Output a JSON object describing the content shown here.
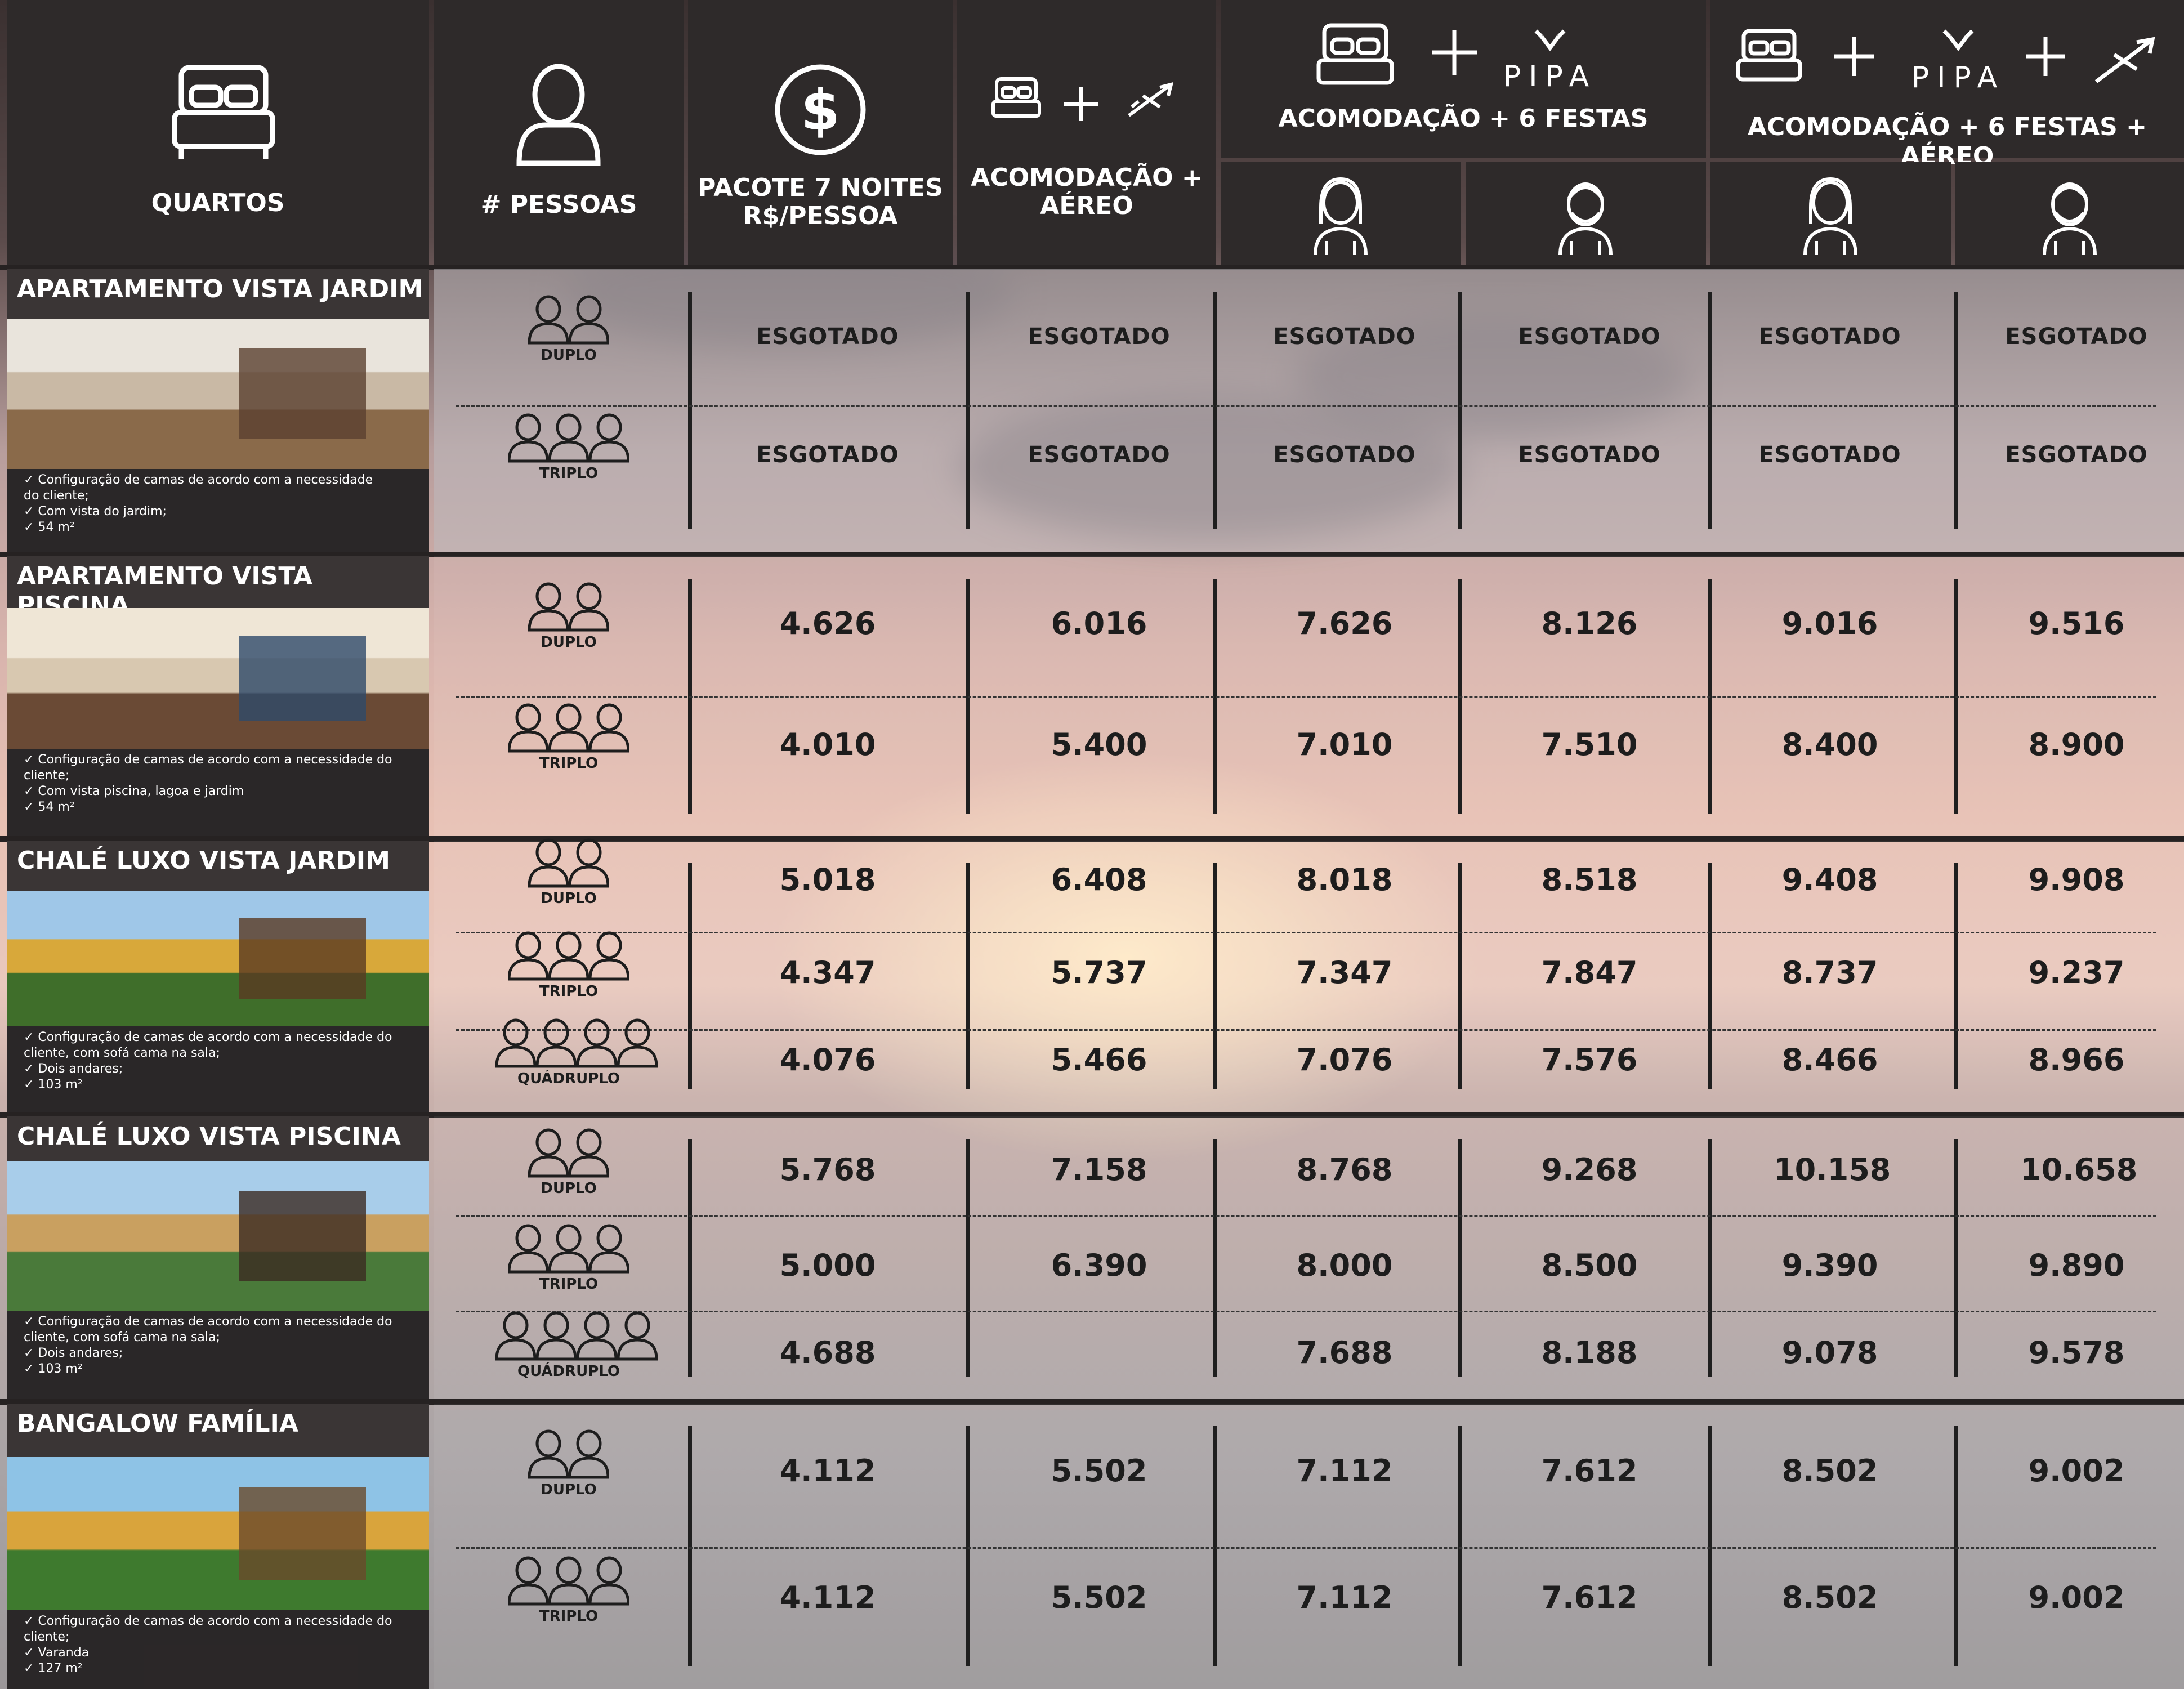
{
  "headers": {
    "quartos": "QUARTOS",
    "pessoas": "# PESSOAS",
    "pacote": [
      "PACOTE 7 NOITES",
      "R$/PESSOA"
    ],
    "acomodacao_aereo": [
      "ACOMODAÇÃO +",
      "AÉREO"
    ],
    "acomodacao_festas": "ACOMODAÇÃO + 6 FESTAS",
    "acomodacao_festas_aereo": "ACOMODAÇÃO + 6 FESTAS + AÉREO",
    "pipa_logo": "PIPA"
  },
  "icons": {
    "bed": "bed-icon",
    "person": "person-icon",
    "dollar": "dollar-icon",
    "plane": "plane-icon",
    "plus": "plus-icon",
    "woman": "woman-icon",
    "man": "man-icon",
    "people": "people-icon"
  },
  "colors": {
    "header_bg": "#2e2a2a",
    "panel_bg": "#3a3535",
    "text_dark": "#1d1d1d"
  },
  "rooms": [
    {
      "title": "APARTAMENTO VISTA JARDIM",
      "features": [
        "✓  Configuração de camas de acordo com a necessidade",
        "    do cliente;",
        "✓  Com vista do jardim;",
        "✓  54 m²"
      ],
      "rows": [
        {
          "occupancy": "DUPLO",
          "values": [
            "ESGOTADO",
            "ESGOTADO",
            "ESGOTADO",
            "ESGOTADO",
            "ESGOTADO",
            "ESGOTADO"
          ]
        },
        {
          "occupancy": "TRIPLO",
          "values": [
            "ESGOTADO",
            "ESGOTADO",
            "ESGOTADO",
            "ESGOTADO",
            "ESGOTADO",
            "ESGOTADO"
          ]
        }
      ]
    },
    {
      "title": "APARTAMENTO VISTA PISCINA",
      "features": [
        "✓  Configuração de camas de acordo com a necessidade do",
        "    cliente;",
        "✓  Com vista piscina, lagoa e jardim",
        "✓  54 m²"
      ],
      "rows": [
        {
          "occupancy": "DUPLO",
          "values": [
            "4.626",
            "6.016",
            "7.626",
            "8.126",
            "9.016",
            "9.516"
          ]
        },
        {
          "occupancy": "TRIPLO",
          "values": [
            "4.010",
            "5.400",
            "7.010",
            "7.510",
            "8.400",
            "8.900"
          ]
        }
      ]
    },
    {
      "title": "CHALÉ LUXO VISTA JARDIM",
      "features": [
        "✓  Configuração de camas de acordo com a necessidade do",
        "    cliente, com sofá cama na sala;",
        "✓  Dois andares;",
        "✓  103 m²"
      ],
      "rows": [
        {
          "occupancy": "DUPLO",
          "values": [
            "5.018",
            "6.408",
            "8.018",
            "8.518",
            "9.408",
            "9.908"
          ]
        },
        {
          "occupancy": "TRIPLO",
          "values": [
            "4.347",
            "5.737",
            "7.347",
            "7.847",
            "8.737",
            "9.237"
          ]
        },
        {
          "occupancy": "QUÁDRUPLO",
          "values": [
            "4.076",
            "5.466",
            "7.076",
            "7.576",
            "8.466",
            "8.966"
          ]
        }
      ]
    },
    {
      "title": "CHALÉ LUXO VISTA PISCINA",
      "features": [
        "✓  Configuração de camas de acordo com a necessidade do",
        "    cliente, com sofá cama na sala;",
        "✓  Dois andares;",
        "✓  103 m²"
      ],
      "rows": [
        {
          "occupancy": "DUPLO",
          "values": [
            "5.768",
            "7.158",
            "8.768",
            "9.268",
            "10.158",
            "10.658"
          ]
        },
        {
          "occupancy": "TRIPLO",
          "values": [
            "5.000",
            "6.390",
            "8.000",
            "8.500",
            "9.390",
            "9.890"
          ]
        },
        {
          "occupancy": "QUÁDRUPLO",
          "values": [
            "4.688",
            "",
            "7.688",
            "8.188",
            "9.078",
            "9.578"
          ]
        }
      ]
    },
    {
      "title": "BANGALOW FAMÍLIA",
      "features": [
        "✓  Configuração de camas de acordo com a necessidade do",
        "    cliente;",
        "✓  Varanda",
        "✓  127 m²"
      ],
      "rows": [
        {
          "occupancy": "DUPLO",
          "values": [
            "4.112",
            "5.502",
            "7.112",
            "7.612",
            "8.502",
            "9.002"
          ]
        },
        {
          "occupancy": "TRIPLO",
          "values": [
            "4.112",
            "5.502",
            "7.112",
            "7.612",
            "8.502",
            "9.002"
          ]
        }
      ]
    }
  ]
}
